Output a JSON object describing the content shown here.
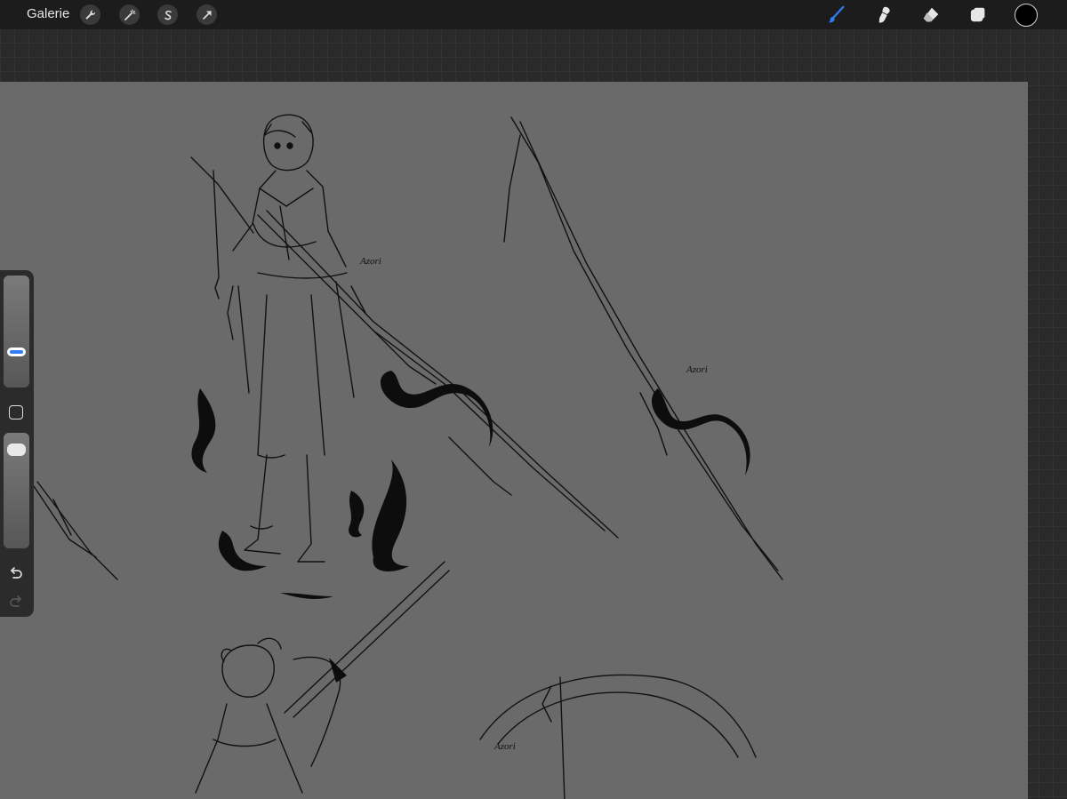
{
  "app": {
    "gallery_label": "Galerie"
  },
  "toolbar_left": {
    "icons": [
      "wrench-icon",
      "magic-wand-icon",
      "selection-icon",
      "transform-arrow-icon"
    ]
  },
  "toolbar_right": {
    "icons": [
      "brush-icon",
      "smudge-icon",
      "eraser-icon",
      "layers-icon"
    ],
    "active_tool": "brush",
    "current_color": "#000000",
    "accent_color": "#2f7cf6"
  },
  "sidebar": {
    "brush_size_level": 0.3,
    "opacity_level": 0.9,
    "icons": [
      "modify-square-icon",
      "undo-icon",
      "redo-icon"
    ]
  },
  "canvas": {
    "background_color": "#6a6a6a",
    "signatures": [
      "Azori",
      "Azori",
      "Azori"
    ]
  }
}
